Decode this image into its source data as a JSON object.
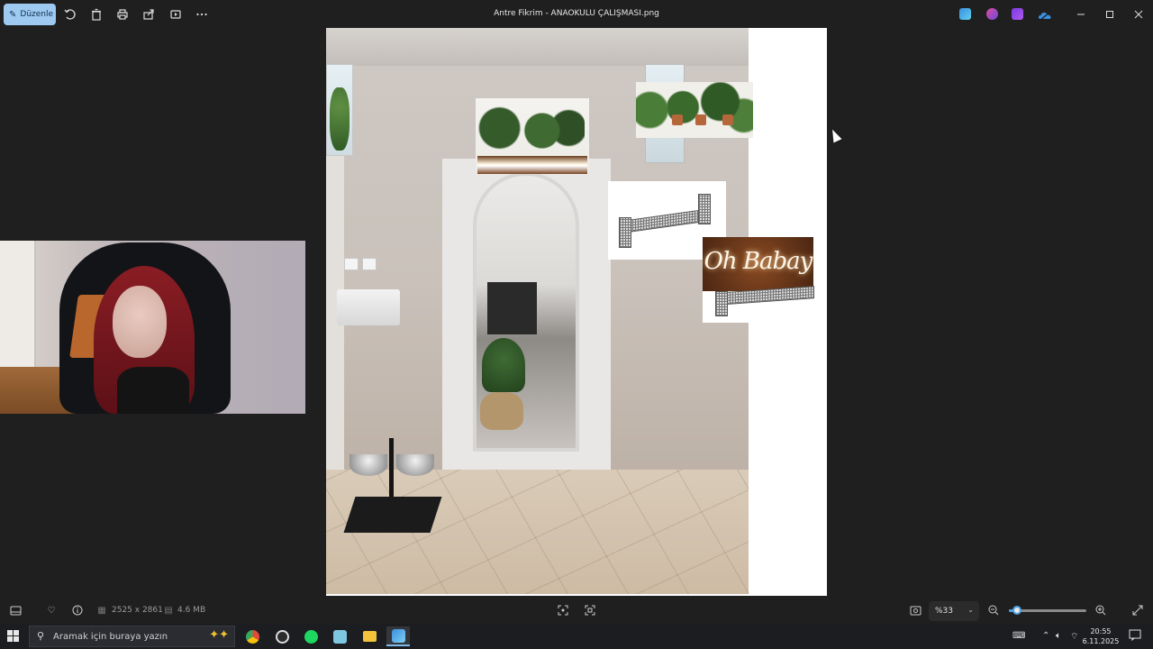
{
  "window": {
    "title": "Antre Fikrim - ANAOKULU ÇALIŞMASI.png"
  },
  "toolbar": {
    "edit_label": "Düzenle",
    "icons": [
      "rotate-icon",
      "delete-icon",
      "print-icon",
      "share-icon",
      "slideshow-icon",
      "more-icon"
    ]
  },
  "title_apps": [
    "photo-editor-icon",
    "designer-icon",
    "clipchamp-icon",
    "onedrive-icon"
  ],
  "collage": {
    "neon_text": "Oh Babay"
  },
  "statusbar": {
    "dimensions": "2525 x 2861",
    "file_size": "4.6 MB",
    "zoom": "%33",
    "zoom_fraction": 0.1
  },
  "taskbar": {
    "search_placeholder": "Aramak için buraya yazın",
    "apps": [
      "chrome",
      "obs",
      "spotify",
      "notes",
      "file-explorer",
      "photos"
    ],
    "time": "20:55",
    "date": "6.11.2025"
  },
  "colors": {
    "accent": "#9ec9f0",
    "background": "#1f1f1f"
  }
}
